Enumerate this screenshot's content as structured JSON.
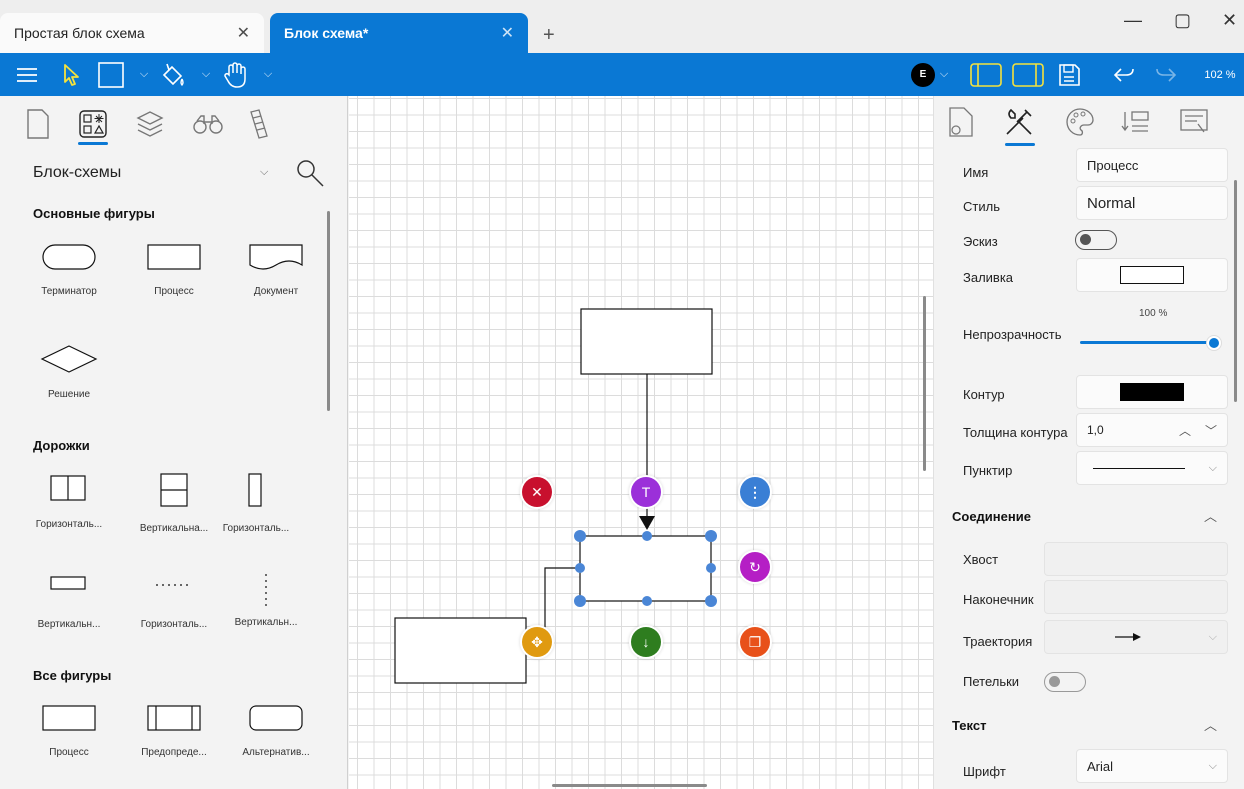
{
  "tabs": [
    {
      "title": "Простая блок схема",
      "close": "✕"
    },
    {
      "title": "Блок схема*",
      "close": "✕"
    }
  ],
  "new_tab": "+",
  "window": {
    "minimize": "—",
    "maximize": "▢",
    "close": "✕"
  },
  "toolbar": {
    "user_initial": "E",
    "zoom": "102 %"
  },
  "left": {
    "library": "Блок-схемы",
    "sections": [
      {
        "title": "Основные фигуры",
        "items": [
          "Терминатор",
          "Процесс",
          "Документ",
          "Решение"
        ]
      },
      {
        "title": "Дорожки",
        "items": [
          "Горизонталь...",
          "Вертикальна...",
          "Горизонталь...",
          "Вертикальн...",
          "Горизонталь...",
          "Вертикальн..."
        ]
      },
      {
        "title": "Все фигуры",
        "items": [
          "Процесс",
          "Предопреде...",
          "Альтернатив..."
        ]
      }
    ]
  },
  "props": {
    "name_label": "Имя",
    "name_value": "Процесс",
    "style_label": "Стиль",
    "style_value": "Normal",
    "sketch_label": "Эскиз",
    "fill_label": "Заливка",
    "opacity_label": "Непрозрачность",
    "opacity_value": "100 %",
    "opacity": 1.0,
    "stroke_label": "Контур",
    "stroke_width_label": "Толщина контура",
    "stroke_width_value": "1,0",
    "dash_label": "Пунктир",
    "connection_section": "Соединение",
    "tail_label": "Хвост",
    "head_label": "Наконечник",
    "path_label": "Траектория",
    "loops_label": "Петельки",
    "text_section": "Текст",
    "font_label": "Шрифт",
    "font_value": "Arial"
  },
  "colors": {
    "accent": "#0a78d4",
    "delete": "#c8102e",
    "text": "#9b30d9",
    "more": "#3a7fd5",
    "rotate": "#b51fc5",
    "move": "#e09a10",
    "down": "#2e7d1f",
    "copy": "#e8511a",
    "handle": "#4a86d6"
  }
}
